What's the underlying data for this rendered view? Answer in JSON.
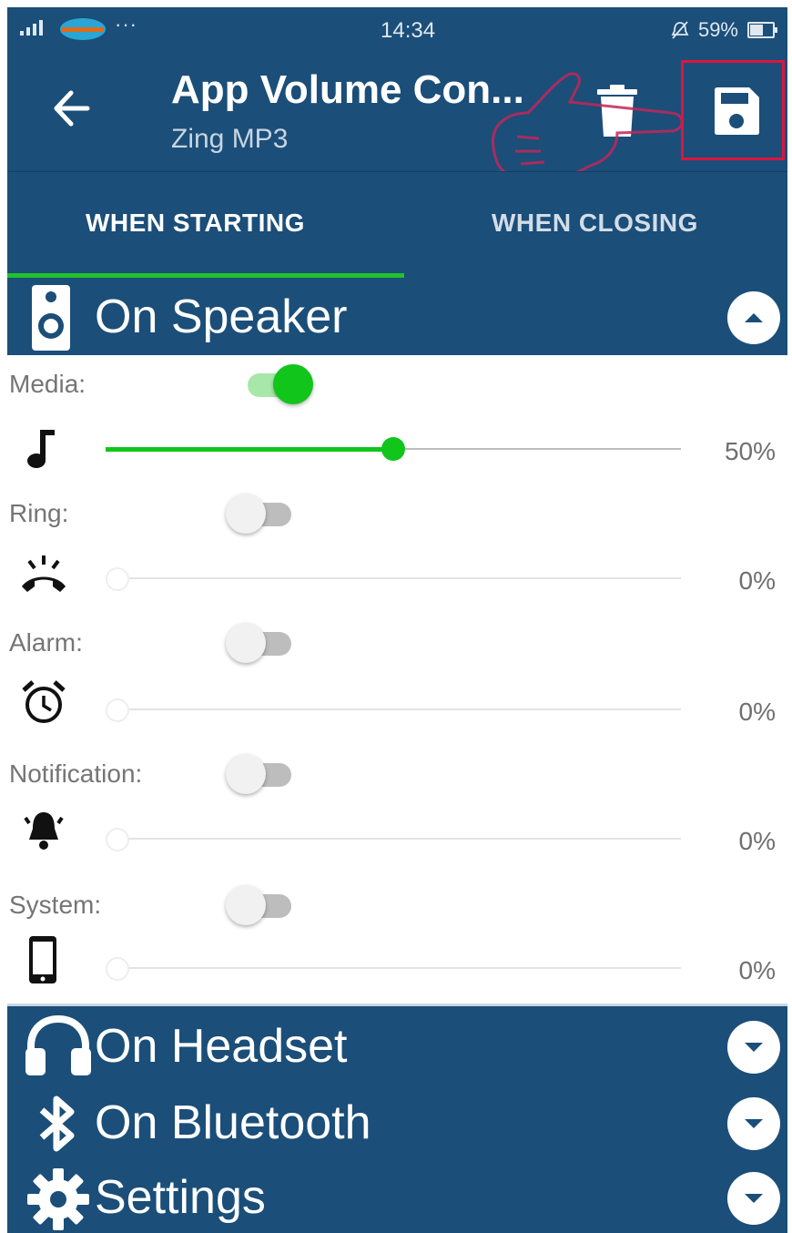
{
  "status_bar": {
    "time": "14:34",
    "battery": "59%",
    "battery_level": 0.59,
    "dots": "···"
  },
  "app_bar": {
    "title": "App Volume Con...",
    "subtitle": "Zing MP3"
  },
  "tabs": [
    {
      "label": "WHEN STARTING",
      "active": true
    },
    {
      "label": "WHEN CLOSING",
      "active": false
    }
  ],
  "speaker": {
    "label": "On Speaker",
    "rows": [
      {
        "label": "Media:",
        "enabled": true,
        "level": 0.5,
        "percent": "50%",
        "icon": "music-note-icon"
      },
      {
        "label": "Ring:",
        "enabled": false,
        "level": 0,
        "percent": "0%",
        "icon": "ringing-phone-icon"
      },
      {
        "label": "Alarm:",
        "enabled": false,
        "level": 0,
        "percent": "0%",
        "icon": "alarm-clock-icon"
      },
      {
        "label": "Notification:",
        "enabled": false,
        "level": 0,
        "percent": "0%",
        "icon": "bell-icon"
      },
      {
        "label": "System:",
        "enabled": false,
        "level": 0,
        "percent": "0%",
        "icon": "phone-icon"
      }
    ]
  },
  "sections": [
    {
      "label": "On Headset",
      "icon": "headset-icon"
    },
    {
      "label": "On Bluetooth",
      "icon": "bluetooth-icon"
    },
    {
      "label": "Settings",
      "icon": "gear-icon"
    }
  ],
  "colors": {
    "primary": "#1b4e79",
    "accent": "#11c51b",
    "highlight": "#d9163f"
  }
}
